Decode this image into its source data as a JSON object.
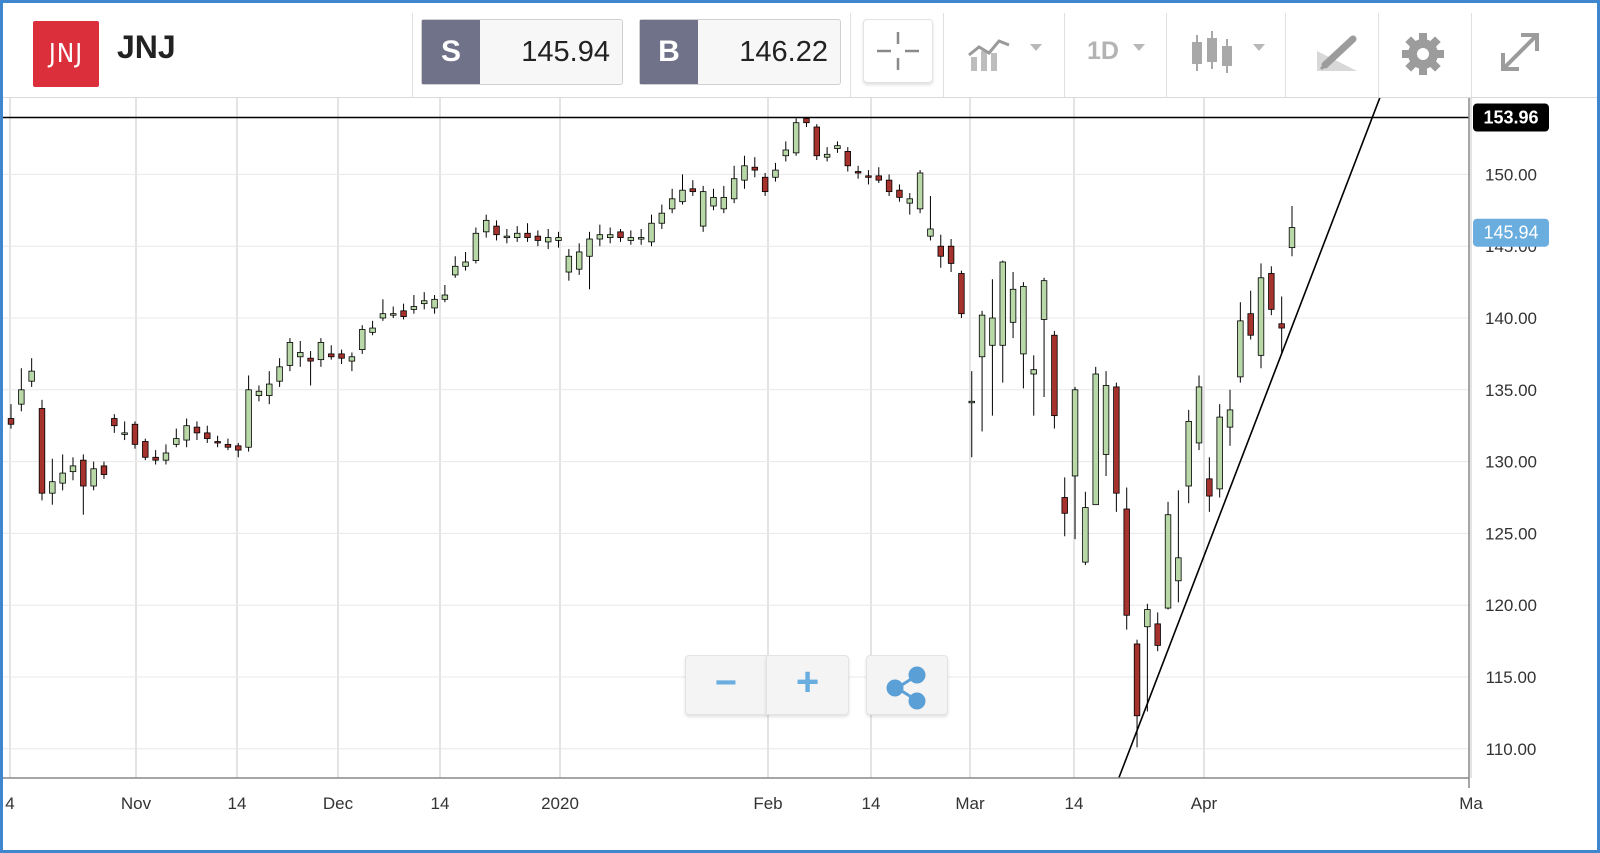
{
  "header": {
    "logo_text": "JNJ",
    "symbol": "JNJ",
    "sell_label": "S",
    "sell_price": "145.94",
    "buy_label": "B",
    "buy_price": "146.22",
    "timeframe": "1D"
  },
  "toolbar_icons": [
    "crosshair-icon",
    "line-chart-icon",
    "candlestick-icon",
    "draw-icon",
    "gear-icon",
    "expand-icon"
  ],
  "zoom_controls": {
    "minus": "−",
    "plus": "+"
  },
  "colors": {
    "up": "#b8d8a8",
    "down": "#a5322c",
    "current_price": "#6aaee0",
    "frame": "#3f86cf",
    "sell_tag": "#6f7288"
  },
  "chart_data": {
    "type": "candlestick",
    "symbol": "JNJ",
    "y_ticks": [
      "110.00",
      "115.00",
      "120.00",
      "125.00",
      "130.00",
      "135.00",
      "140.00",
      "145.00",
      "150.00"
    ],
    "x_ticks": [
      "4",
      "Nov",
      "14",
      "Dec",
      "14",
      "2020",
      "Feb",
      "14",
      "Mar",
      "14",
      "Apr",
      "Ma"
    ],
    "ylim": [
      108,
      156
    ],
    "horizontal_line": {
      "label": "153.96",
      "value": 153.96
    },
    "current_price": {
      "label": "145.94",
      "value": 145.94
    },
    "trendline": [
      {
        "x": 0,
        "y": 108
      },
      {
        "x": 1,
        "y": 157
      }
    ],
    "candles": [
      [
        133,
        132.6,
        134,
        132.3
      ],
      [
        134,
        135,
        136.5,
        133.5
      ],
      [
        135.6,
        136.3,
        137.2,
        135.2
      ],
      [
        133.7,
        127.8,
        134.3,
        127.3
      ],
      [
        127.8,
        128.6,
        130.2,
        127
      ],
      [
        128.5,
        129.2,
        130.5,
        128
      ],
      [
        129.3,
        129.7,
        130.3,
        128.7
      ],
      [
        130.1,
        128.3,
        130.5,
        126.3
      ],
      [
        128.3,
        129.5,
        130,
        128
      ],
      [
        129.7,
        129.1,
        130,
        128.8
      ],
      [
        133,
        132.5,
        133.3,
        132
      ],
      [
        132,
        132,
        132.8,
        131.5
      ],
      [
        132.6,
        131.2,
        132.8,
        130.9
      ],
      [
        131.4,
        130.3,
        131.6,
        130.1
      ],
      [
        130.3,
        130.1,
        130.8,
        129.8
      ],
      [
        130.1,
        130.6,
        131.2,
        129.8
      ],
      [
        131.2,
        131.6,
        132.3,
        131
      ],
      [
        131.5,
        132.5,
        133,
        131
      ],
      [
        132.4,
        132,
        132.8,
        131.5
      ],
      [
        132,
        131.6,
        132.5,
        131.3
      ],
      [
        131.4,
        131.3,
        131.8,
        131
      ],
      [
        131.2,
        131,
        131.6,
        130.8
      ],
      [
        131.1,
        130.8,
        131.3,
        130.3
      ],
      [
        131,
        135,
        136,
        130.7
      ],
      [
        134.6,
        134.9,
        135.3,
        134.2
      ],
      [
        134.6,
        135.4,
        136.3,
        134
      ],
      [
        135.6,
        136.6,
        137.2,
        135.2
      ],
      [
        136.7,
        138.3,
        138.6,
        136.3
      ],
      [
        137.3,
        137.6,
        138.4,
        136.6
      ],
      [
        137.2,
        137,
        137.7,
        135.3
      ],
      [
        137.1,
        138.3,
        138.6,
        136.6
      ],
      [
        137.5,
        137.3,
        138.1,
        137.1
      ],
      [
        137.5,
        137.2,
        137.8,
        136.8
      ],
      [
        137,
        137.3,
        137.6,
        136.3
      ],
      [
        137.8,
        139.2,
        139.5,
        137.5
      ],
      [
        139,
        139.3,
        139.8,
        138.8
      ],
      [
        140,
        140.3,
        141.3,
        139.8
      ],
      [
        140.2,
        140.3,
        140.8,
        140
      ],
      [
        140.5,
        140.1,
        141,
        139.9
      ],
      [
        140.6,
        140.8,
        141.6,
        140.3
      ],
      [
        141,
        141.2,
        141.8,
        140.6
      ],
      [
        140.7,
        141.3,
        141.6,
        140.3
      ],
      [
        141.3,
        141.6,
        142.3,
        141.1
      ],
      [
        143,
        143.6,
        144.3,
        142.8
      ],
      [
        143.6,
        143.9,
        144.6,
        143.3
      ],
      [
        144,
        145.9,
        146.3,
        143.8
      ],
      [
        146,
        146.8,
        147.2,
        145.6
      ],
      [
        146.4,
        145.8,
        146.8,
        145.4
      ],
      [
        145.7,
        145.7,
        146.2,
        145.2
      ],
      [
        145.6,
        145.9,
        146.4,
        145.3
      ],
      [
        145.9,
        145.6,
        146.6,
        145.3
      ],
      [
        145.7,
        145.4,
        146.1,
        145
      ],
      [
        145.3,
        145.6,
        146.2,
        144.8
      ],
      [
        145.4,
        145.6,
        146,
        144.9
      ],
      [
        143.2,
        144.3,
        144.8,
        142.6
      ],
      [
        143.4,
        144.6,
        145.2,
        143
      ],
      [
        144.3,
        145.5,
        146,
        142
      ],
      [
        145.5,
        145.8,
        146.5,
        145
      ],
      [
        145.6,
        145.8,
        146.3,
        145.2
      ],
      [
        146,
        145.6,
        146.2,
        145.3
      ],
      [
        145.4,
        145.6,
        146.1,
        145.1
      ],
      [
        145.6,
        145.6,
        146.2,
        145.1
      ],
      [
        145.3,
        146.6,
        147.2,
        145
      ],
      [
        146.6,
        147.3,
        147.9,
        146.2
      ],
      [
        147.6,
        148.3,
        149,
        147.3
      ],
      [
        148.1,
        148.9,
        150,
        147.9
      ],
      [
        149,
        148.8,
        149.6,
        148.5
      ],
      [
        146.4,
        148.8,
        149.2,
        146
      ],
      [
        147.8,
        148.4,
        149,
        147.5
      ],
      [
        147.6,
        148.4,
        149.2,
        147.3
      ],
      [
        148.3,
        149.7,
        150.6,
        148
      ],
      [
        149.6,
        150.6,
        151.3,
        149
      ],
      [
        150.5,
        150.3,
        151.2,
        149.8
      ],
      [
        149.8,
        148.8,
        150.1,
        148.5
      ],
      [
        149.8,
        150.3,
        150.8,
        149.5
      ],
      [
        151.3,
        151.7,
        152.3,
        150.9
      ],
      [
        151.5,
        153.6,
        153.9,
        151.3
      ],
      [
        153.9,
        153.6,
        154,
        153.3
      ],
      [
        153.3,
        151.3,
        153.5,
        151
      ],
      [
        151.2,
        151.4,
        151.9,
        150.9
      ],
      [
        151.8,
        152,
        152.3,
        151.5
      ],
      [
        151.6,
        150.6,
        151.9,
        150.2
      ],
      [
        150.2,
        150.1,
        150.6,
        149.7
      ],
      [
        149.9,
        149.8,
        150.3,
        149.3
      ],
      [
        149.9,
        149.6,
        150.5,
        149.4
      ],
      [
        149.6,
        148.8,
        150,
        148.5
      ],
      [
        148.9,
        148.4,
        149.3,
        148.1
      ],
      [
        148,
        148.3,
        148.7,
        147.2
      ],
      [
        147.6,
        150.1,
        150.3,
        147.3
      ],
      [
        145.7,
        146.2,
        148.5,
        145.4
      ],
      [
        145,
        144.3,
        145.8,
        143.5
      ],
      [
        145,
        143.8,
        145.5,
        143.2
      ],
      [
        143.1,
        140.3,
        143.3,
        140
      ],
      [
        134.1,
        134.2,
        136.3,
        130.3
      ],
      [
        137.3,
        140.2,
        140.5,
        132.1
      ],
      [
        138.1,
        140,
        142.7,
        133.2
      ],
      [
        138.1,
        143.9,
        144,
        135.5
      ],
      [
        139.7,
        142,
        143.2,
        138.6
      ],
      [
        137.5,
        142.2,
        142.5,
        135.1
      ],
      [
        136.1,
        136.4,
        137.4,
        133.2
      ],
      [
        139.9,
        142.6,
        142.8,
        134.5
      ],
      [
        138.8,
        133.2,
        139.1,
        132.3
      ],
      [
        127.5,
        126.4,
        128.9,
        124.8
      ],
      [
        129,
        135,
        135.2,
        124.6
      ],
      [
        123,
        126.8,
        127.9,
        122.8
      ],
      [
        127,
        136.1,
        136.6,
        127
      ],
      [
        130.5,
        135.3,
        136.3,
        129
      ],
      [
        135.2,
        127.8,
        135.5,
        126.5
      ],
      [
        126.7,
        119.3,
        128.2,
        118.3
      ],
      [
        117.3,
        112.3,
        117.6,
        110.1
      ],
      [
        118.5,
        119.7,
        120.1,
        112.6
      ],
      [
        118.7,
        117.2,
        119.5,
        116.8
      ],
      [
        119.8,
        126.3,
        127.2,
        119.7
      ],
      [
        121.7,
        123.3,
        128,
        120.2
      ],
      [
        128.3,
        132.8,
        133.6,
        127.1
      ],
      [
        131.3,
        135.2,
        136,
        130.8
      ],
      [
        128.8,
        127.6,
        130.3,
        126.5
      ],
      [
        128.1,
        133.1,
        134,
        127.5
      ],
      [
        132.4,
        133.6,
        135,
        131.1
      ],
      [
        135.9,
        139.8,
        141.1,
        135.5
      ],
      [
        140.3,
        138.8,
        141.9,
        138.5
      ],
      [
        137.4,
        142.8,
        143.8,
        136.5
      ],
      [
        143.1,
        140.6,
        143.6,
        140.2
      ],
      [
        139.6,
        139.3,
        141.5,
        137.6
      ],
      [
        144.9,
        146.3,
        147.8,
        144.3
      ]
    ]
  }
}
